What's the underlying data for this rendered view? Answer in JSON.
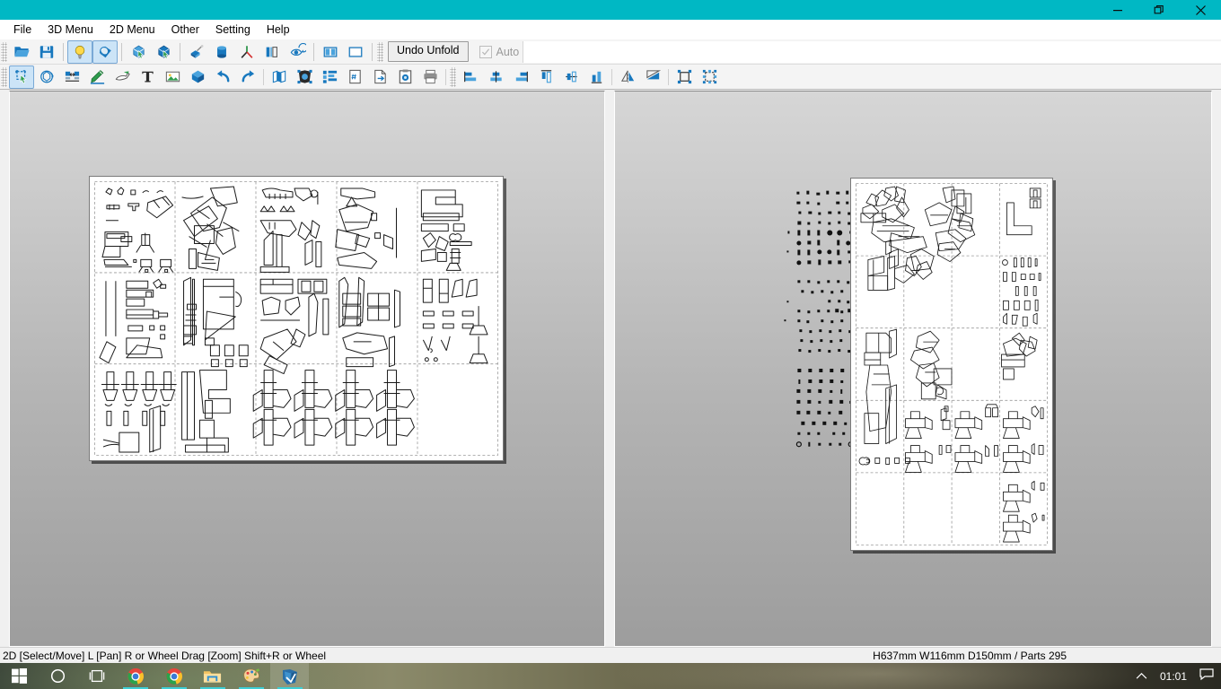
{
  "window": {
    "accent_color": "#00b8c4",
    "controls": [
      {
        "name": "minimize",
        "glyph": "minimize-icon"
      },
      {
        "name": "restore",
        "glyph": "restore-icon"
      },
      {
        "name": "close",
        "glyph": "close-icon"
      }
    ]
  },
  "menu": {
    "items": [
      {
        "label": "File"
      },
      {
        "label": "3D Menu"
      },
      {
        "label": "2D Menu"
      },
      {
        "label": "Other"
      },
      {
        "label": "Setting"
      },
      {
        "label": "Help"
      }
    ]
  },
  "toolbar1": {
    "buttons": [
      {
        "name": "open-file-icon",
        "tip": "Open"
      },
      {
        "name": "save-file-icon",
        "tip": "Save"
      },
      {
        "name": "light-bulb-icon",
        "tip": "Lighting",
        "active": true
      },
      {
        "name": "texture-sphere-icon",
        "tip": "Texture",
        "active": true
      },
      {
        "name": "select-face-icon",
        "tip": "Select Face"
      },
      {
        "name": "select-part-icon",
        "tip": "Select Part"
      },
      {
        "name": "paint-box-icon",
        "tip": "Paint"
      },
      {
        "name": "cylinder-icon",
        "tip": "Cylinder"
      },
      {
        "name": "axis-icon",
        "tip": "Axis"
      },
      {
        "name": "flaps-icon",
        "tip": "Flaps"
      },
      {
        "name": "eye-rotate-icon",
        "tip": "View"
      },
      {
        "name": "split-view-icon",
        "tip": "Split Window"
      },
      {
        "name": "single-view-icon",
        "tip": "Single Window"
      }
    ],
    "undo_unfold_label": "Undo Unfold",
    "auto_label": "Auto",
    "auto_checked": true,
    "auto_enabled": false
  },
  "toolbar2": {
    "buttons": [
      {
        "name": "select-move-icon",
        "tip": "Select / Move",
        "active": true
      },
      {
        "name": "rotate-part-icon",
        "tip": "Rotate Part"
      },
      {
        "name": "join-disjoin-icon",
        "tip": "Join / Disjoin Face"
      },
      {
        "name": "edit-flap-icon",
        "tip": "Edit Flap"
      },
      {
        "name": "erase-flap-icon",
        "tip": "Erase Flap"
      },
      {
        "name": "text-tool-icon",
        "tip": "Add Text"
      },
      {
        "name": "image-tool-icon",
        "tip": "Add Image"
      },
      {
        "name": "shape-tool-icon",
        "tip": "Add Shape"
      },
      {
        "name": "undo-icon",
        "tip": "Undo"
      },
      {
        "name": "redo-icon",
        "tip": "Redo"
      },
      {
        "name": "page-layout-icon",
        "tip": "Page Layout"
      },
      {
        "name": "fit-parts-icon",
        "tip": "Fit Parts"
      },
      {
        "name": "arrange-parts-icon",
        "tip": "Arrange Parts"
      },
      {
        "name": "page-number-icon",
        "tip": "Page Number"
      },
      {
        "name": "export-page-icon",
        "tip": "Export"
      },
      {
        "name": "clipboard-icon",
        "tip": "Clipboard"
      },
      {
        "name": "print-icon",
        "tip": "Print"
      },
      {
        "name": "align-left-icon",
        "tip": "Align Left"
      },
      {
        "name": "align-center-h-icon",
        "tip": "Align Center"
      },
      {
        "name": "align-right-icon",
        "tip": "Align Right"
      },
      {
        "name": "align-top-icon",
        "tip": "Align Top"
      },
      {
        "name": "align-middle-v-icon",
        "tip": "Align Middle"
      },
      {
        "name": "align-bottom-icon",
        "tip": "Align Bottom"
      },
      {
        "name": "flip-horizontal-icon",
        "tip": "Flip Horizontal"
      },
      {
        "name": "flip-vertical-icon",
        "tip": "Flip Vertical"
      },
      {
        "name": "group-parts-icon",
        "tip": "Group"
      },
      {
        "name": "ungroup-parts-icon",
        "tip": "Ungroup"
      }
    ]
  },
  "workspace": {
    "left_pane": {
      "name": "2d-unfold-pane",
      "sheet": {
        "columns": 5,
        "rows": 3,
        "background": "#ffffff"
      }
    },
    "right_pane": {
      "name": "3d-model-pane",
      "sheet": {
        "columns": 4,
        "rows": 5,
        "background": "#ffffff"
      }
    }
  },
  "statusbar": {
    "hint": "2D [Select/Move] L [Pan] R or Wheel Drag [Zoom] Shift+R or Wheel",
    "dimensions": "H637mm W116mm D150mm / Parts 295"
  },
  "taskbar": {
    "items": [
      {
        "name": "start-button",
        "icon": "windows-logo-icon"
      },
      {
        "name": "cortana-search",
        "icon": "circle-icon"
      },
      {
        "name": "task-view",
        "icon": "task-view-icon"
      },
      {
        "name": "chrome-1",
        "icon": "chrome-icon",
        "running": true
      },
      {
        "name": "chrome-2",
        "icon": "chrome-icon",
        "running": true
      },
      {
        "name": "file-explorer",
        "icon": "folder-icon",
        "running": true
      },
      {
        "name": "paint-app",
        "icon": "paint-palette-icon",
        "running": true
      },
      {
        "name": "pepakura-app",
        "icon": "pepakura-icon",
        "running": true,
        "focused": true
      }
    ],
    "tray": {
      "chevron": "chevron-up-icon",
      "clock": "01:01",
      "action_center": "action-center-icon"
    }
  }
}
